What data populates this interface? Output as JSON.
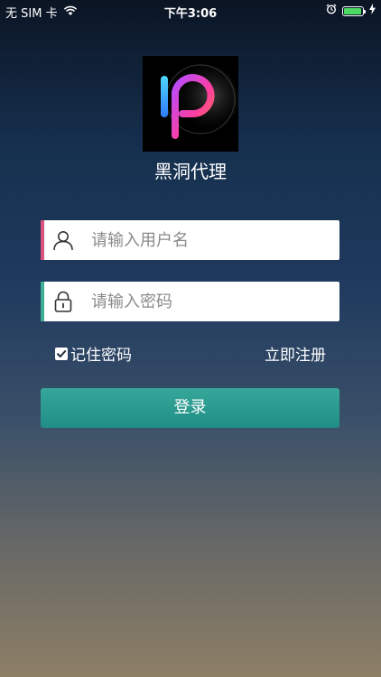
{
  "status_bar": {
    "carrier": "无 SIM 卡",
    "time": "下午3:06",
    "battery_level": 0.95,
    "icons": [
      "wifi-icon",
      "alarm-icon",
      "battery-icon",
      "charging-icon"
    ]
  },
  "app": {
    "name": "黑洞代理",
    "logo_icon": "ip-logo-icon"
  },
  "form": {
    "username_placeholder": "请输入用户名",
    "password_placeholder": "请输入密码",
    "remember_label": "记住密码",
    "remember_checked": true,
    "register_label": "立即注册",
    "login_label": "登录"
  },
  "colors": {
    "username_accent": "#d8537d",
    "password_accent": "#3fae95",
    "button": "#2a9a8f",
    "battery": "#4cd964"
  }
}
